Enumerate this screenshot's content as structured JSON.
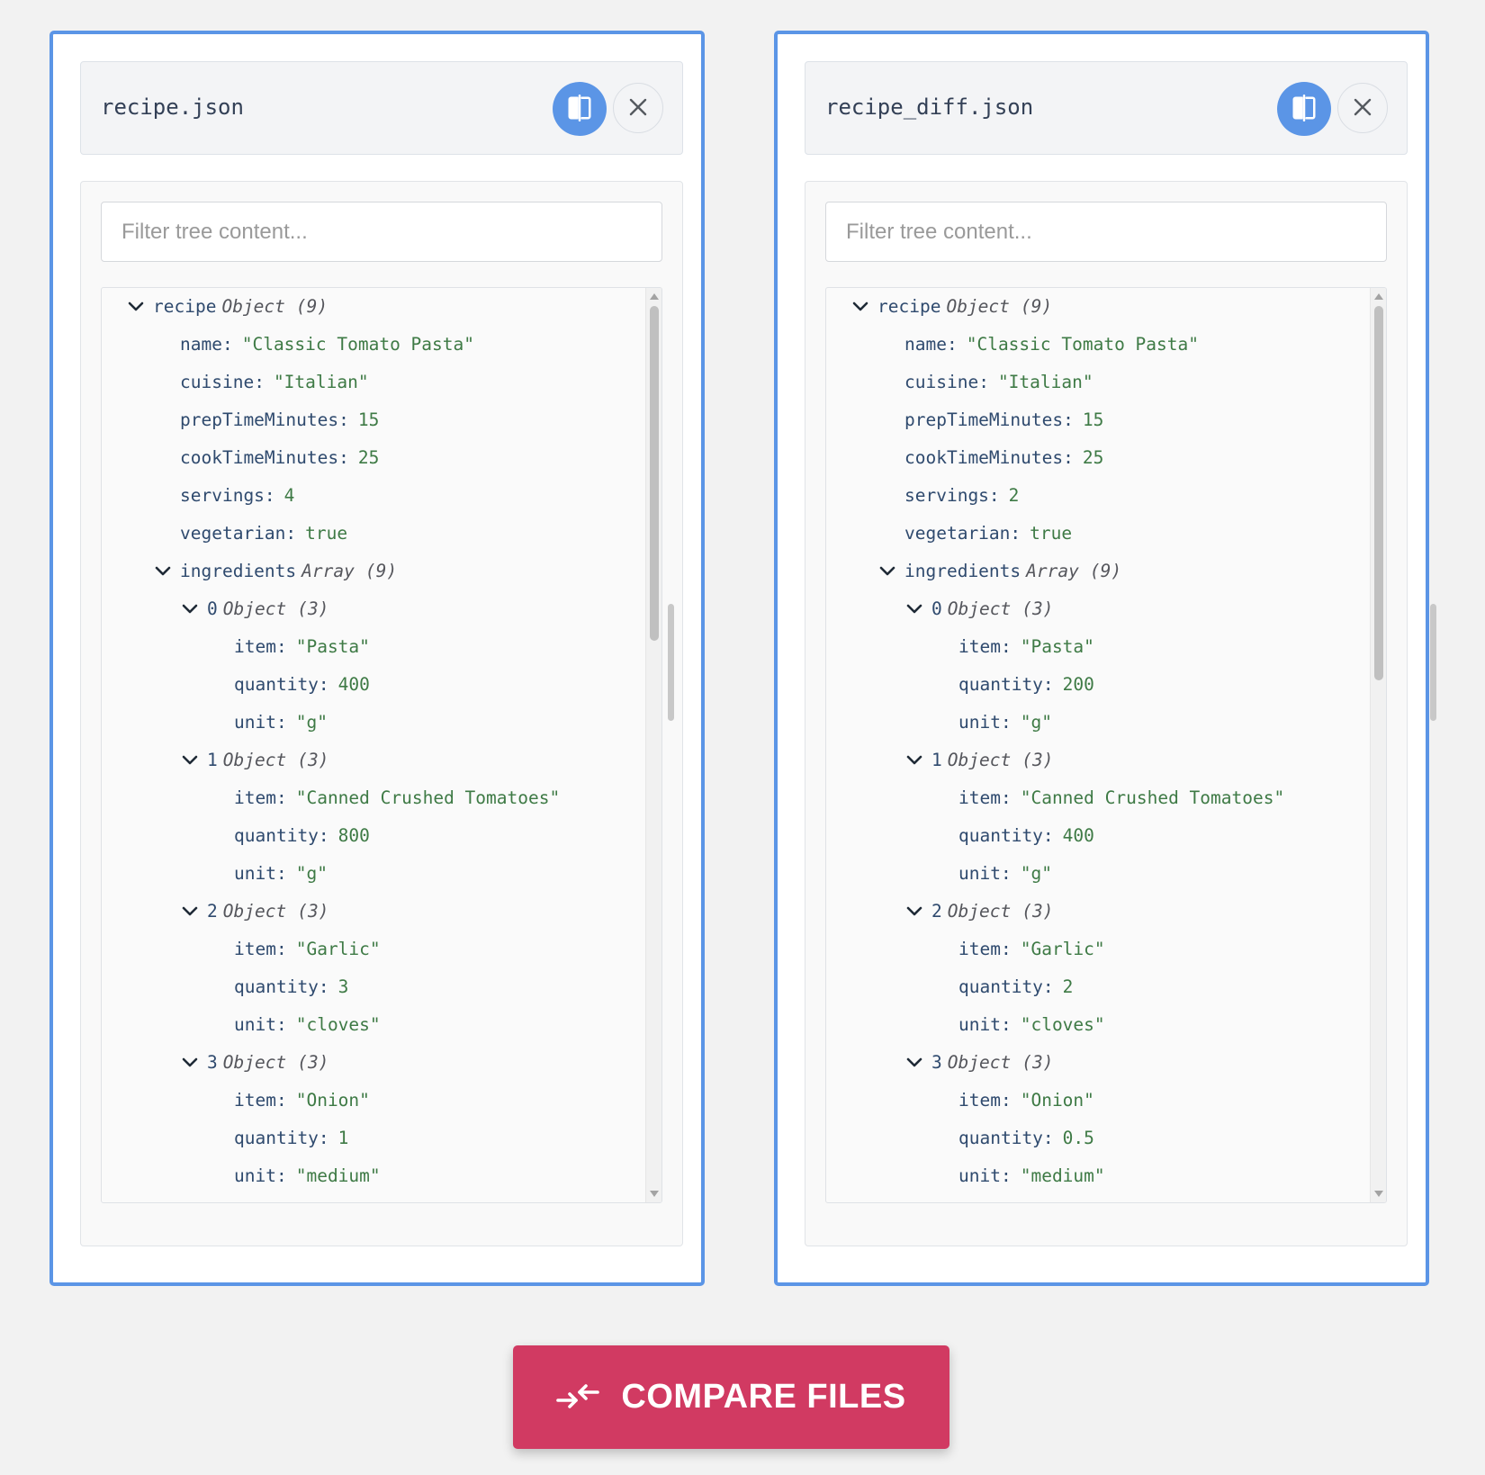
{
  "colors": {
    "accent": "#5b95e6",
    "compare_button": "#d13a62",
    "string_value": "#3e7a45",
    "key": "#2f4a6e"
  },
  "icons": {
    "swap": "swap-panels-icon",
    "close": "close-icon",
    "expand": "chevron-down-icon",
    "compare": "compare-arrows-icon"
  },
  "panels": [
    {
      "file_name": "recipe.json",
      "filter_placeholder": "Filter tree content...",
      "rows": [
        {
          "depth": 0,
          "expandable": true,
          "key": "recipe",
          "type": "Object",
          "count": "(9)"
        },
        {
          "depth": 1,
          "key": "name",
          "value": "\"Classic Tomato Pasta\""
        },
        {
          "depth": 1,
          "key": "cuisine",
          "value": "\"Italian\""
        },
        {
          "depth": 1,
          "key": "prepTimeMinutes",
          "value": "15"
        },
        {
          "depth": 1,
          "key": "cookTimeMinutes",
          "value": "25"
        },
        {
          "depth": 1,
          "key": "servings",
          "value": "4"
        },
        {
          "depth": 1,
          "key": "vegetarian",
          "value": "true"
        },
        {
          "depth": 1,
          "expandable": true,
          "key": "ingredients",
          "type": "Array",
          "count": "(9)"
        },
        {
          "depth": 2,
          "expandable": true,
          "key": "0",
          "type": "Object",
          "count": "(3)"
        },
        {
          "depth": 3,
          "key": "item",
          "value": "\"Pasta\""
        },
        {
          "depth": 3,
          "key": "quantity",
          "value": "400"
        },
        {
          "depth": 3,
          "key": "unit",
          "value": "\"g\""
        },
        {
          "depth": 2,
          "expandable": true,
          "key": "1",
          "type": "Object",
          "count": "(3)"
        },
        {
          "depth": 3,
          "key": "item",
          "value": "\"Canned Crushed Tomatoes\""
        },
        {
          "depth": 3,
          "key": "quantity",
          "value": "800"
        },
        {
          "depth": 3,
          "key": "unit",
          "value": "\"g\""
        },
        {
          "depth": 2,
          "expandable": true,
          "key": "2",
          "type": "Object",
          "count": "(3)"
        },
        {
          "depth": 3,
          "key": "item",
          "value": "\"Garlic\""
        },
        {
          "depth": 3,
          "key": "quantity",
          "value": "3"
        },
        {
          "depth": 3,
          "key": "unit",
          "value": "\"cloves\""
        },
        {
          "depth": 2,
          "expandable": true,
          "key": "3",
          "type": "Object",
          "count": "(3)"
        },
        {
          "depth": 3,
          "key": "item",
          "value": "\"Onion\""
        },
        {
          "depth": 3,
          "key": "quantity",
          "value": "1"
        },
        {
          "depth": 3,
          "key": "unit",
          "value": "\"medium\""
        }
      ]
    },
    {
      "file_name": "recipe_diff.json",
      "filter_placeholder": "Filter tree content...",
      "rows": [
        {
          "depth": 0,
          "expandable": true,
          "key": "recipe",
          "type": "Object",
          "count": "(9)"
        },
        {
          "depth": 1,
          "key": "name",
          "value": "\"Classic Tomato Pasta\""
        },
        {
          "depth": 1,
          "key": "cuisine",
          "value": "\"Italian\""
        },
        {
          "depth": 1,
          "key": "prepTimeMinutes",
          "value": "15"
        },
        {
          "depth": 1,
          "key": "cookTimeMinutes",
          "value": "25"
        },
        {
          "depth": 1,
          "key": "servings",
          "value": "2"
        },
        {
          "depth": 1,
          "key": "vegetarian",
          "value": "true"
        },
        {
          "depth": 1,
          "expandable": true,
          "key": "ingredients",
          "type": "Array",
          "count": "(9)"
        },
        {
          "depth": 2,
          "expandable": true,
          "key": "0",
          "type": "Object",
          "count": "(3)"
        },
        {
          "depth": 3,
          "key": "item",
          "value": "\"Pasta\""
        },
        {
          "depth": 3,
          "key": "quantity",
          "value": "200"
        },
        {
          "depth": 3,
          "key": "unit",
          "value": "\"g\""
        },
        {
          "depth": 2,
          "expandable": true,
          "key": "1",
          "type": "Object",
          "count": "(3)"
        },
        {
          "depth": 3,
          "key": "item",
          "value": "\"Canned Crushed Tomatoes\""
        },
        {
          "depth": 3,
          "key": "quantity",
          "value": "400"
        },
        {
          "depth": 3,
          "key": "unit",
          "value": "\"g\""
        },
        {
          "depth": 2,
          "expandable": true,
          "key": "2",
          "type": "Object",
          "count": "(3)"
        },
        {
          "depth": 3,
          "key": "item",
          "value": "\"Garlic\""
        },
        {
          "depth": 3,
          "key": "quantity",
          "value": "2"
        },
        {
          "depth": 3,
          "key": "unit",
          "value": "\"cloves\""
        },
        {
          "depth": 2,
          "expandable": true,
          "key": "3",
          "type": "Object",
          "count": "(3)"
        },
        {
          "depth": 3,
          "key": "item",
          "value": "\"Onion\""
        },
        {
          "depth": 3,
          "key": "quantity",
          "value": "0.5"
        },
        {
          "depth": 3,
          "key": "unit",
          "value": "\"medium\""
        }
      ]
    }
  ],
  "compare_button": {
    "label": "COMPARE FILES"
  }
}
